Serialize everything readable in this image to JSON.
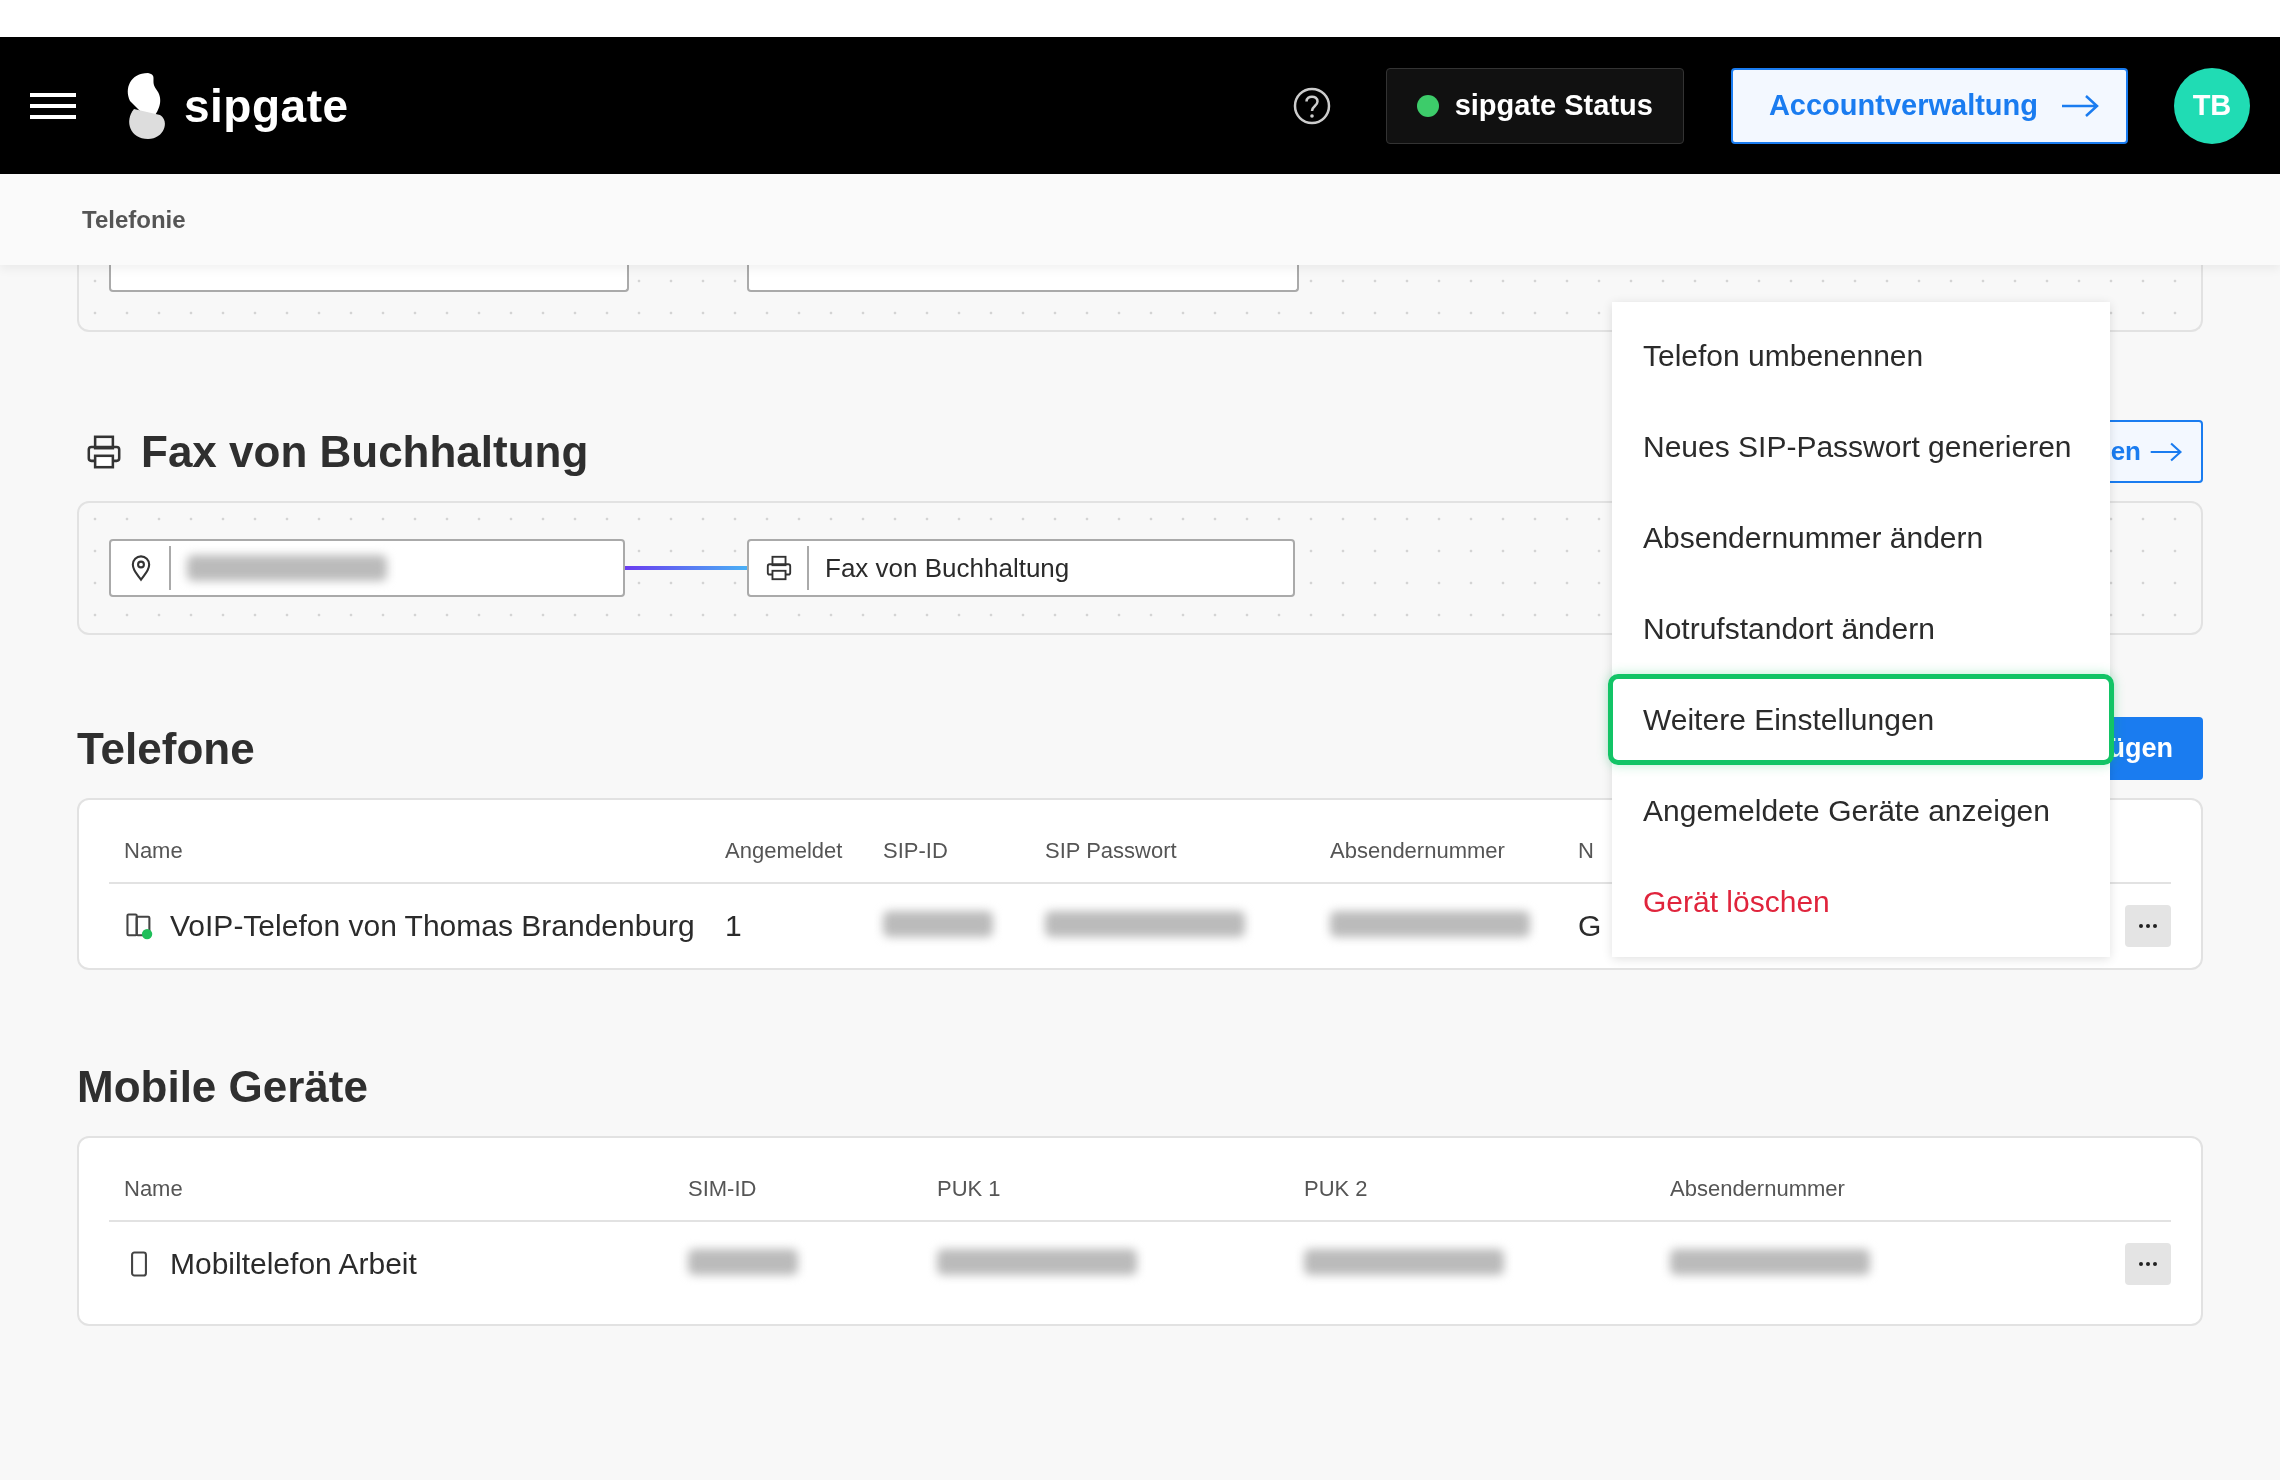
{
  "header": {
    "logo": "sipgate",
    "status_button": "sipgate Status",
    "account_button": "Accountverwaltung",
    "avatar": "TB"
  },
  "breadcrumb": "Telefonie",
  "fax_section": {
    "title": "Fax von Buchhaltung",
    "button_text": "en",
    "target_value": "Fax von Buchhaltung"
  },
  "phones": {
    "title": "Telefone",
    "button_text": "ügen",
    "columns": [
      "Name",
      "Angemeldet",
      "SIP-ID",
      "SIP Passwort",
      "Absendernummer",
      "N"
    ],
    "rows": [
      {
        "name": "VoIP-Telefon von Thomas Brandenburg",
        "online": true,
        "logged_in": "1",
        "column_6": "G"
      }
    ]
  },
  "mobile": {
    "title": "Mobile Geräte",
    "columns": [
      "Name",
      "SIM-ID",
      "PUK 1",
      "PUK 2",
      "Absendernummer"
    ],
    "rows": [
      {
        "name": "Mobiltelefon Arbeit"
      }
    ]
  },
  "menu": {
    "items": [
      {
        "label": "Telefon umbenennen",
        "kind": "normal",
        "selected": false
      },
      {
        "label": "Neues SIP-Passwort generieren",
        "kind": "normal",
        "selected": false
      },
      {
        "label": "Absendernummer ändern",
        "kind": "normal",
        "selected": false
      },
      {
        "label": "Notrufstandort ändern",
        "kind": "normal",
        "selected": false
      },
      {
        "label": "Weitere Einstellungen",
        "kind": "normal",
        "selected": true
      },
      {
        "label": "Angemeldete Geräte anzeigen",
        "kind": "normal",
        "selected": false
      },
      {
        "label": "Gerät löschen",
        "kind": "danger",
        "selected": false
      }
    ]
  }
}
